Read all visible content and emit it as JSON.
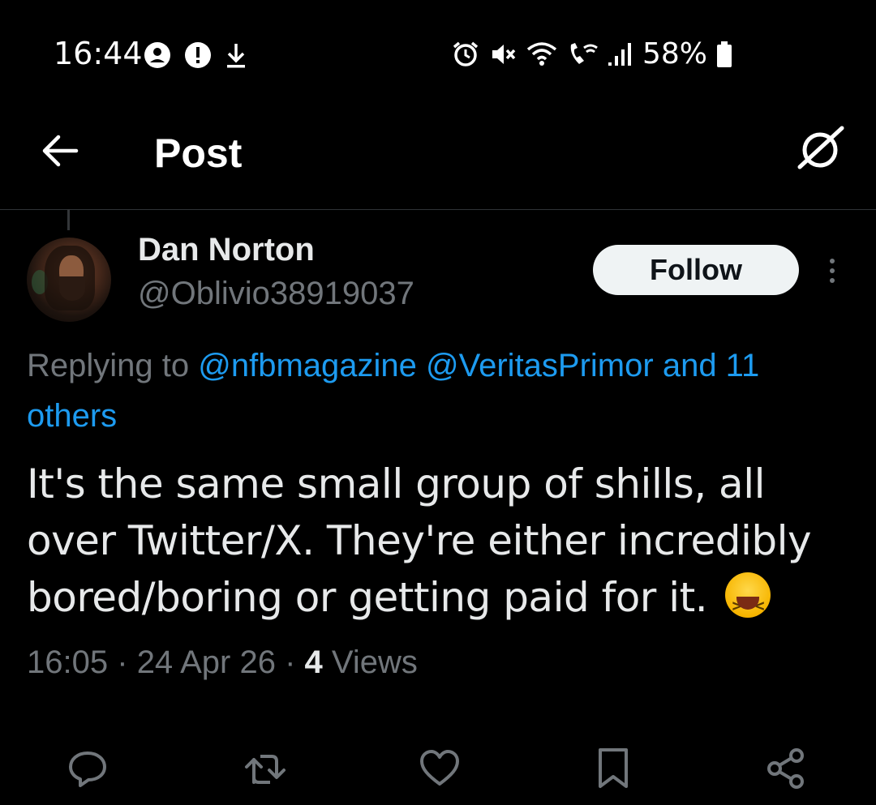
{
  "status_bar": {
    "time": "16:44",
    "battery_percent": "58%",
    "icons": [
      "account-icon",
      "alert-icon",
      "download-icon",
      "alarm-icon",
      "mute-icon",
      "wifi-icon",
      "wifi-call-icon",
      "signal-icon",
      "battery-icon"
    ]
  },
  "header": {
    "title": "Post",
    "back_icon": "arrow-left-icon",
    "right_icon": "grok-icon"
  },
  "post": {
    "display_name": "Dan Norton",
    "handle": "@Oblivio38919037",
    "follow_label": "Follow",
    "replying_prefix": "Replying to",
    "replying_to": [
      "@nfbmagazine",
      "@VeritasPrimor"
    ],
    "replying_and": "and 11",
    "replying_others": "others",
    "text": "It's the same small group of shills, all over Twitter/X.  They're either incredibly bored/boring or getting paid for it.",
    "emoji": "laughing-squint-emoji",
    "time": "16:05",
    "date": "24 Apr 26",
    "views_count": "4",
    "views_label": "Views",
    "separator": "·"
  },
  "actions": [
    "reply-icon",
    "repost-icon",
    "like-icon",
    "bookmark-icon",
    "share-icon"
  ],
  "colors": {
    "background": "#000000",
    "text": "#e7e9ea",
    "muted": "#71767b",
    "link": "#1d9bf0",
    "follow_bg": "#eff3f4"
  }
}
